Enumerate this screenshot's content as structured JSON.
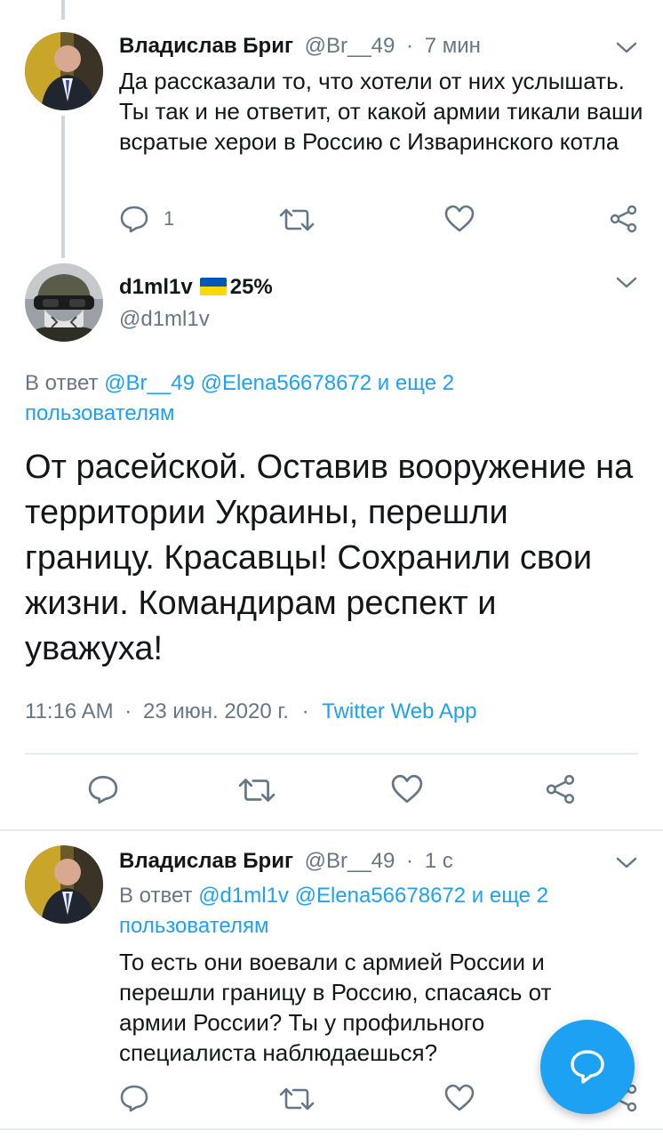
{
  "tweet1": {
    "name": "Владислав Бриг",
    "handle": "@Br__49",
    "sep": "·",
    "time": "7 мин",
    "text": "Да рассказали то, что хотели от них услышать. Ты так и не ответит, от какой армии тикали ваши всратые херои в Россию с Изваринского котла",
    "reply_count": "1"
  },
  "main": {
    "name": "d1ml1v",
    "flag_text": "25%",
    "handle": "@d1ml1v",
    "reply_prefix": "В ответ",
    "reply_users": "@Br__49 @Elena56678672 и еще 2",
    "reply_users_line2": "пользователям",
    "text": "От расейской. Оставив вооружение на территории Украины, перешли границу. Красавцы! Сохранили свои жизни. Командирам респект и уважуха!",
    "time": "11:16 AM",
    "sep": "·",
    "date": "23 июн. 2020 г.",
    "sep2": "·",
    "source": "Twitter Web App"
  },
  "tweet2": {
    "name": "Владислав Бриг",
    "handle": "@Br__49",
    "sep": "·",
    "time": "1 с",
    "reply_prefix": "В ответ",
    "reply_users": "@d1ml1v @Elena56678672 и еще 2",
    "reply_users_line2": "пользователям",
    "text": "То есть они воевали с армией России и перешли границу в Россию, спасаясь от армии России? Ты у профильного специалиста наблюдаешься?"
  },
  "colors": {
    "accent": "#1da1f2",
    "muted": "#657786",
    "text": "#14171a",
    "ukraine_blue": "#0057b7",
    "ukraine_yellow": "#ffd700"
  },
  "icons": {
    "reply": "reply-icon",
    "retweet": "retweet-icon",
    "like": "heart-icon",
    "share": "share-icon",
    "caret": "chevron-down-icon",
    "compose": "compose-reply-icon"
  }
}
